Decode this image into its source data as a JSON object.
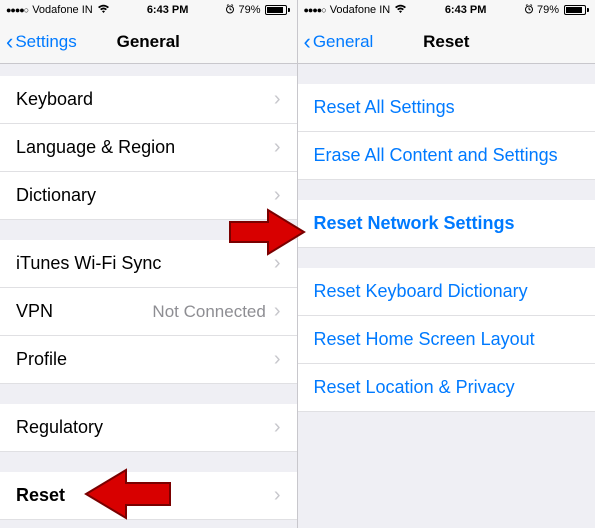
{
  "statusbar": {
    "carrier": "Vodafone IN",
    "time": "6:43 PM",
    "battery_pct": "79%"
  },
  "left": {
    "nav": {
      "back": "Settings",
      "title": "General"
    },
    "rows": {
      "keyboard": "Keyboard",
      "language_region": "Language & Region",
      "dictionary": "Dictionary",
      "itunes_wifi_sync": "iTunes Wi-Fi Sync",
      "vpn": "VPN",
      "vpn_detail": "Not Connected",
      "profile": "Profile",
      "regulatory": "Regulatory",
      "reset": "Reset"
    }
  },
  "right": {
    "nav": {
      "back": "General",
      "title": "Reset"
    },
    "rows": {
      "reset_all": "Reset All Settings",
      "erase_all": "Erase All Content and Settings",
      "reset_network": "Reset Network Settings",
      "reset_keyboard": "Reset Keyboard Dictionary",
      "reset_home": "Reset Home Screen Layout",
      "reset_location": "Reset Location & Privacy"
    }
  }
}
